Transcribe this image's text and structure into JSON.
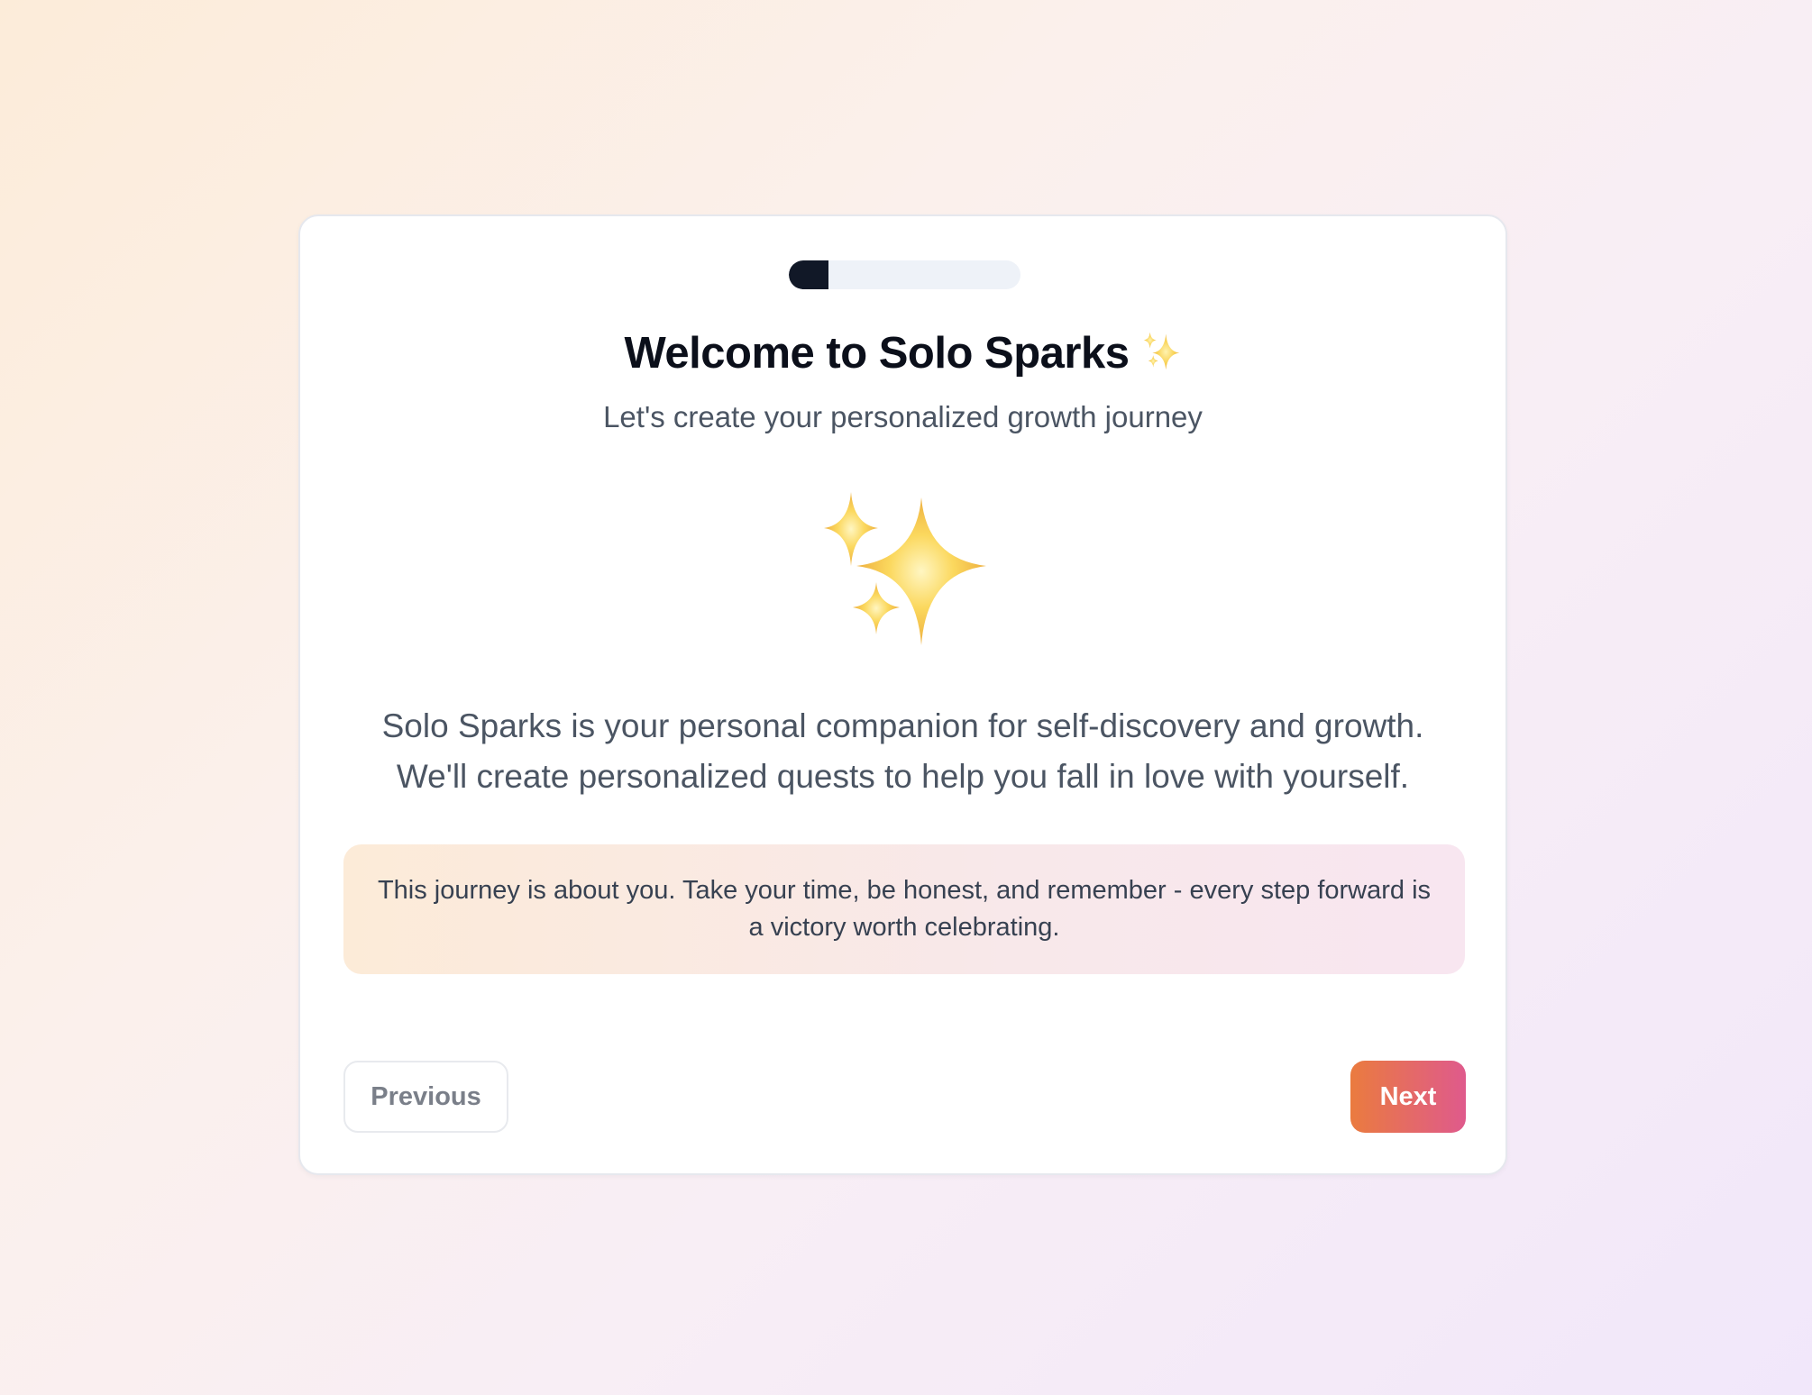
{
  "onboarding": {
    "progress": {
      "fraction": 0.17,
      "fill_color": "#111827",
      "track_color": "#eef2f8"
    },
    "title": "Welcome to Solo Sparks",
    "title_icon": "sparkles-icon",
    "subtitle": "Let's create your personalized growth journey",
    "hero_icon": "sparkles-icon",
    "description_line1": "Solo Sparks is your personal companion for self-discovery and growth.",
    "description_line2": "We'll create personalized quests to help you fall in love with yourself.",
    "note": "This journey is about you. Take your time, be honest, and remember - every step forward is a victory worth celebrating.",
    "buttons": {
      "previous_label": "Previous",
      "next_label": "Next"
    },
    "colors": {
      "accent_start": "#ea7b3f",
      "accent_end": "#df5a8c",
      "sparkle_yellow": "#f7c948"
    }
  }
}
